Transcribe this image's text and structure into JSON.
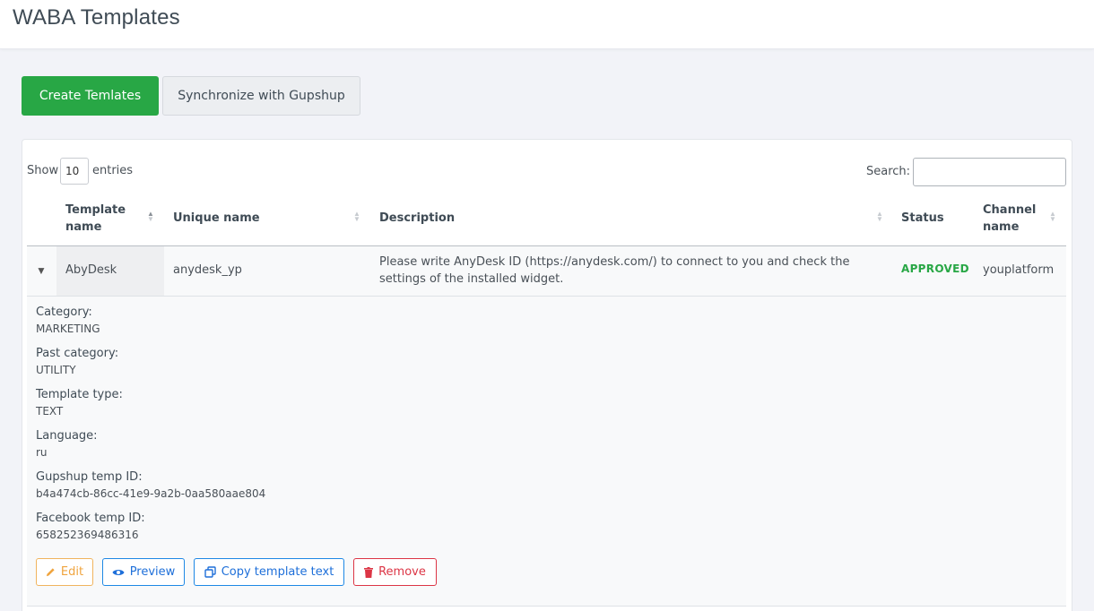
{
  "header": {
    "title": "WABA Templates"
  },
  "toolbar": {
    "create_label": "Create Temlates",
    "sync_label": "Synchronize with Gupshup"
  },
  "table_controls": {
    "show_label": "Show",
    "entries_value": "10",
    "entries_label": "entries",
    "search_label": "Search:",
    "search_value": ""
  },
  "table": {
    "columns": [
      {
        "line1": "Template",
        "line2": "name"
      },
      {
        "line1": "Unique name"
      },
      {
        "line1": "Description"
      },
      {
        "line1": "Status"
      },
      {
        "line1": "Channel",
        "line2": "name"
      }
    ],
    "rows": [
      {
        "template_name": "AbyDesk",
        "unique_name": "anydesk_yp",
        "description_line1": "Please write AnyDesk ID (https://anydesk.com/) to connect to you and check the",
        "description_line2": "settings of the installed widget.",
        "status": "APPROVED",
        "channel_name": "youplatform"
      }
    ]
  },
  "details": [
    {
      "key": "Category:",
      "value": "MARKETING"
    },
    {
      "key": "Past category:",
      "value": "UTILITY"
    },
    {
      "key": "Template type:",
      "value": "TEXT"
    },
    {
      "key": "Language:",
      "value": "ru"
    },
    {
      "key": "Gupshup temp ID:",
      "value": "b4a474cb-86cc-41e9-9a2b-0aa580aae804"
    },
    {
      "key": "Facebook temp ID:",
      "value": "658252369486316"
    }
  ],
  "actions": {
    "edit": "Edit",
    "preview": "Preview",
    "copy": "Copy template text",
    "remove": "Remove"
  },
  "colors": {
    "success": "#28a745",
    "primary": "#1e88e5",
    "warning": "#f0b45e",
    "danger": "#dc3545"
  },
  "icons": {
    "edit": "pencil-icon",
    "preview": "eye-icon",
    "copy": "copy-icon",
    "remove": "trash-icon",
    "expand": "caret-down-icon"
  }
}
